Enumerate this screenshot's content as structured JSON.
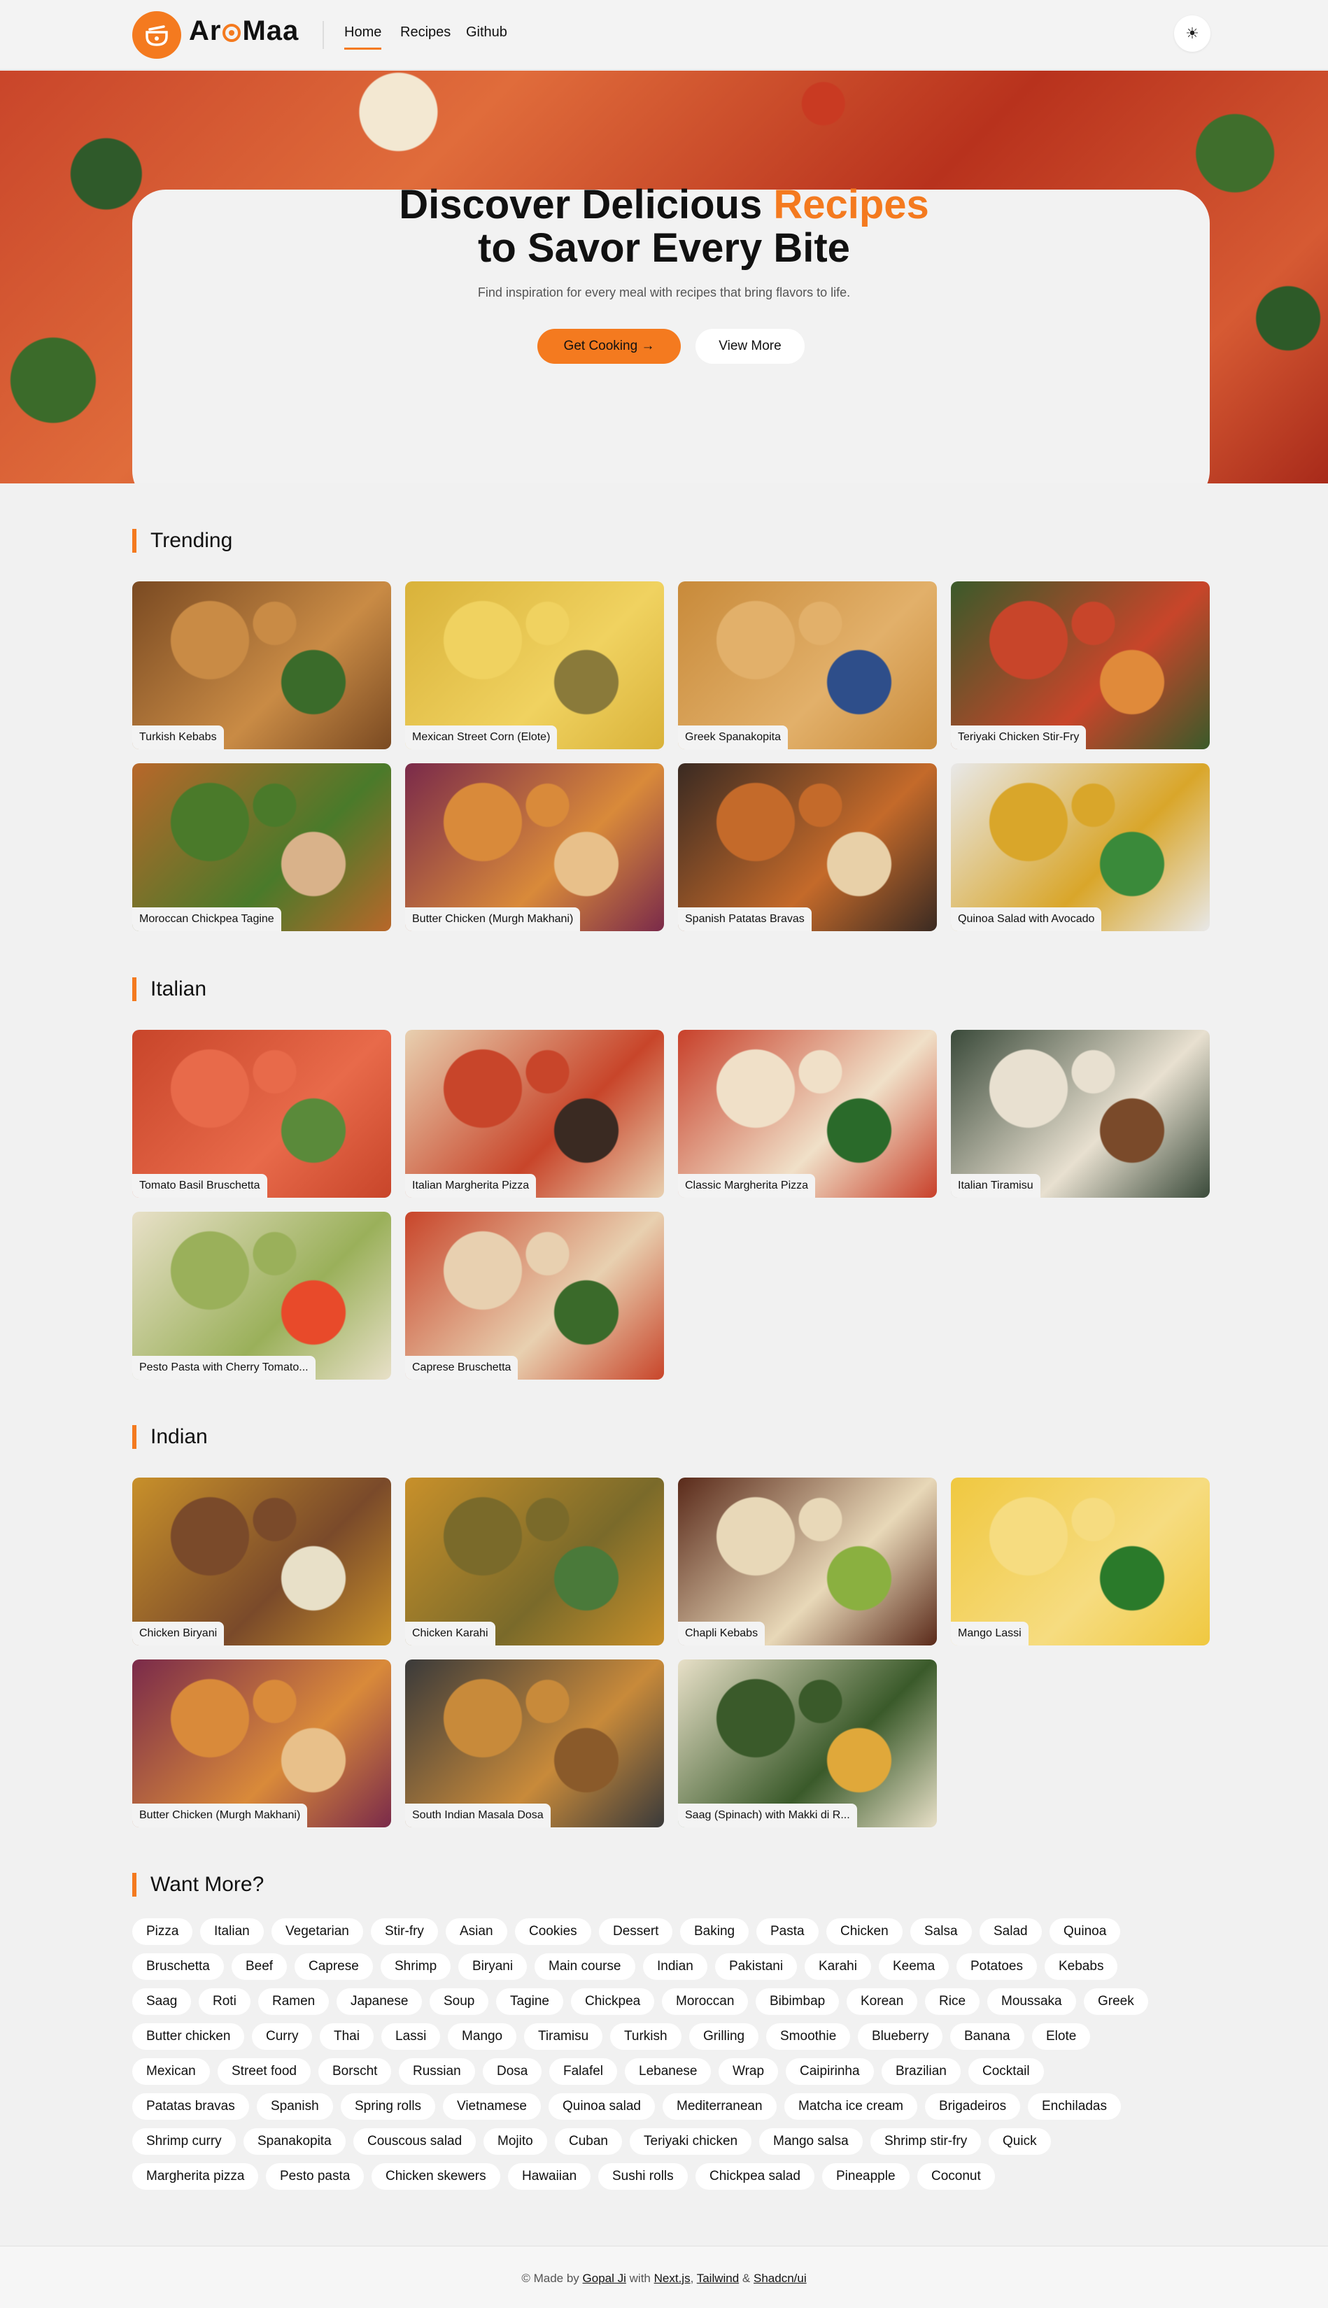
{
  "brand": {
    "name_pre": "Ar",
    "name_post": "Maa",
    "accent": "#f47a1f"
  },
  "nav": {
    "home": "Home",
    "recipes": "Recipes",
    "github": "Github"
  },
  "theme_toggle": "☀",
  "hero": {
    "title_line1": "Discover Delicious ",
    "title_accent": "Recipes",
    "title_line2": "to Savor Every Bite",
    "subtitle": "Find inspiration for every meal with recipes that bring flavors to life.",
    "primary_button": "Get Cooking →",
    "secondary_button": "View More"
  },
  "sections": {
    "trending": {
      "title": "Trending",
      "cards": [
        "Turkish Kebabs",
        "Mexican Street Corn (Elote)",
        "Greek Spanakopita",
        "Teriyaki Chicken Stir-Fry",
        "Moroccan Chickpea Tagine",
        "Butter Chicken (Murgh Makhani)",
        "Spanish Patatas Bravas",
        "Quinoa Salad with Avocado"
      ]
    },
    "italian": {
      "title": "Italian",
      "cards": [
        "Tomato Basil Bruschetta",
        "Italian Margherita Pizza",
        "Classic Margherita Pizza",
        "Italian Tiramisu",
        "Pesto Pasta with Cherry Tomato...",
        "Caprese Bruschetta"
      ]
    },
    "indian": {
      "title": "Indian",
      "cards": [
        "Chicken Biryani",
        "Chicken Karahi",
        "Chapli Kebabs",
        "Mango Lassi",
        "Butter Chicken (Murgh Makhani)",
        "South Indian Masala Dosa",
        "Saag (Spinach) with Makki di R..."
      ]
    },
    "want_more": {
      "title": "Want More?"
    }
  },
  "tags": [
    [
      "Pizza",
      "Italian",
      "Vegetarian",
      "Stir-fry",
      "Asian",
      "Cookies",
      "Dessert",
      "Baking",
      "Pasta",
      "Chicken",
      "Salsa",
      "Salad",
      "Quinoa"
    ],
    [
      "Bruschetta",
      "Beef",
      "Caprese",
      "Shrimp",
      "Biryani",
      "Main course",
      "Indian",
      "Pakistani",
      "Karahi",
      "Keema",
      "Potatoes",
      "Kebabs"
    ],
    [
      "Saag",
      "Roti",
      "Ramen",
      "Japanese",
      "Soup",
      "Tagine",
      "Chickpea",
      "Moroccan",
      "Bibimbap",
      "Korean",
      "Rice",
      "Moussaka",
      "Greek"
    ],
    [
      "Butter chicken",
      "Curry",
      "Thai",
      "Lassi",
      "Mango",
      "Tiramisu",
      "Turkish",
      "Grilling",
      "Smoothie",
      "Blueberry",
      "Banana",
      "Elote"
    ],
    [
      "Mexican",
      "Street food",
      "Borscht",
      "Russian",
      "Dosa",
      "Falafel",
      "Lebanese",
      "Wrap",
      "Caipirinha",
      "Brazilian",
      "Cocktail"
    ],
    [
      "Patatas bravas",
      "Spanish",
      "Spring rolls",
      "Vietnamese",
      "Quinoa salad",
      "Mediterranean",
      "Matcha ice cream",
      "Brigadeiros",
      "Enchiladas"
    ],
    [
      "Shrimp curry",
      "Spanakopita",
      "Couscous salad",
      "Mojito",
      "Cuban",
      "Teriyaki chicken",
      "Mango salsa",
      "Shrimp stir-fry",
      "Quick"
    ],
    [
      "Margherita pizza",
      "Pesto pasta",
      "Chicken skewers",
      "Hawaiian",
      "Sushi rolls",
      "Chickpea salad",
      "Pineapple",
      "Coconut"
    ]
  ],
  "footer": {
    "made_by": "© Made by ",
    "author": "Gopal Ji",
    "with": " with ",
    "tech1": "Next.js",
    "comma": ", ",
    "tech2": "Tailwind",
    "amp": " & ",
    "tech3": "Shadcn/ui"
  }
}
